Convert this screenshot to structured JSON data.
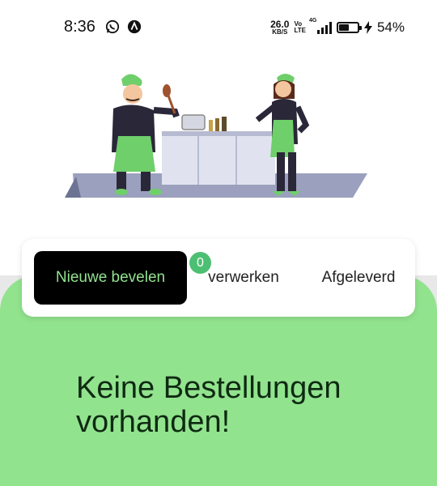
{
  "status_bar": {
    "time": "8:36",
    "net_speed_value": "26.0",
    "net_speed_unit": "KB/S",
    "volte_top": "Vo",
    "volte_bottom": "LTE",
    "network_label": "4G",
    "battery_percent": "54%",
    "battery_level": 0.54,
    "icons": [
      "whatsapp-icon",
      "app-notification-icon",
      "signal-icon",
      "battery-icon",
      "charging-icon"
    ]
  },
  "tabs": [
    {
      "label": "Nieuwe bevelen",
      "active": true
    },
    {
      "label": "verwerken",
      "active": false,
      "badge": "0"
    },
    {
      "label": "Afgeleverd",
      "active": false
    }
  ],
  "main": {
    "empty_message": "Keine Bestellungen vorhanden!"
  },
  "colors": {
    "accent_green": "#92e38e",
    "badge_green": "#4cbf73",
    "active_tab_bg": "#000000"
  }
}
